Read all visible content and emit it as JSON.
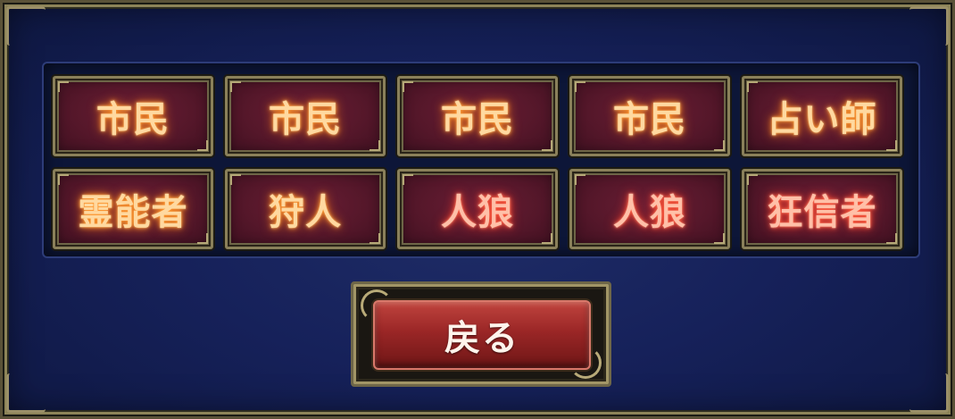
{
  "roles": [
    {
      "label": "市民",
      "team": "village"
    },
    {
      "label": "市民",
      "team": "village"
    },
    {
      "label": "市民",
      "team": "village"
    },
    {
      "label": "市民",
      "team": "village"
    },
    {
      "label": "占い師",
      "team": "village"
    },
    {
      "label": "霊能者",
      "team": "village"
    },
    {
      "label": "狩人",
      "team": "village"
    },
    {
      "label": "人狼",
      "team": "wolf"
    },
    {
      "label": "人狼",
      "team": "wolf"
    },
    {
      "label": "狂信者",
      "team": "wolf"
    }
  ],
  "back_button": {
    "label": "戻る"
  },
  "colors": {
    "card_glow": "#ff9a2a",
    "wolf_glow": "#ff5a3a",
    "button_red": "#9a2626",
    "panel_bg": "#0d1638"
  }
}
